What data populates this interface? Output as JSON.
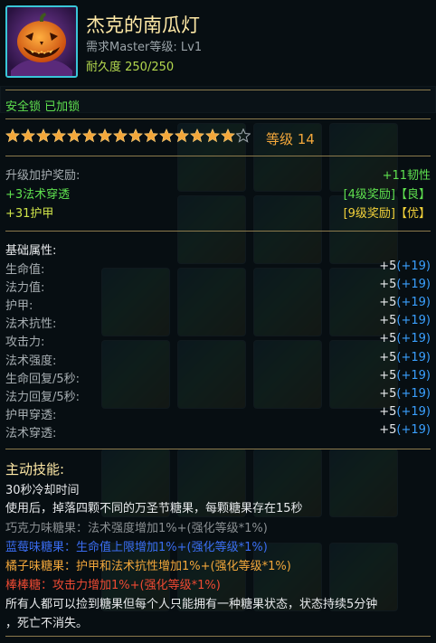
{
  "item": {
    "name": "杰克的南瓜灯",
    "requirement": "需求Master等级: Lv1",
    "durability": "耐久度 250/250",
    "lock_status": "安全锁 已加锁",
    "icon": "pumpkin-lantern-icon"
  },
  "enhance": {
    "stars_filled": 15,
    "stars_total": 16,
    "level_label": "等级 14"
  },
  "upgrade_bonus": {
    "label": "升级加护奖励:",
    "value": "+11韧性",
    "lines": [
      {
        "text": "+3法术穿透",
        "tag": "[4级奖励]",
        "quality": "【良】"
      },
      {
        "text": "+31护甲",
        "tag": "[9级奖励]",
        "quality": "【优】"
      }
    ]
  },
  "base_attrs": {
    "label": "基础属性:",
    "rows": [
      {
        "name": "生命值:",
        "base": "+5",
        "bonus": "(+19)"
      },
      {
        "name": "法力值:",
        "base": "+5",
        "bonus": "(+19)"
      },
      {
        "name": "护甲:",
        "base": "+5",
        "bonus": "(+19)"
      },
      {
        "name": "法术抗性:",
        "base": "+5",
        "bonus": "(+19)"
      },
      {
        "name": "攻击力:",
        "base": "+5",
        "bonus": "(+19)"
      },
      {
        "name": "法术强度:",
        "base": "+5",
        "bonus": "(+19)"
      },
      {
        "name": "生命回复/5秒:",
        "base": "+5",
        "bonus": "(+19)"
      },
      {
        "name": "法力回复/5秒:",
        "base": "+5",
        "bonus": "(+19)"
      },
      {
        "name": "护甲穿透:",
        "base": "+5",
        "bonus": "(+19)"
      },
      {
        "name": "法术穿透:",
        "base": "+5",
        "bonus": "(+19)"
      }
    ]
  },
  "skill": {
    "label": "主动技能:",
    "cooldown": "30秒冷却时间",
    "desc": "使用后，掉落四颗不同的万圣节糖果，每颗糖果存在15秒",
    "candies": [
      {
        "text": "巧克力味糖果：法术强度增加1%+(强化等级*1%)",
        "color": "#8a8f92"
      },
      {
        "text": "蓝莓味糖果：生命值上限增加1%+(强化等级*1%)",
        "color": "#3a6cf0"
      },
      {
        "text": "橘子味糖果：护甲和法术抗性增加1%+(强化等级*1%)",
        "color": "#f3a73b"
      },
      {
        "text": "棒棒糖：攻击力增加1%+(强化等级*1%)",
        "color": "#ee4a33"
      }
    ],
    "note_1": "所有人都可以捡到糖果但每个人只能拥有一种糖果状态，状态持续5分钟",
    "note_2": "，死亡不消失。"
  },
  "colors": {
    "title": "#ffe9a6",
    "green": "#5fe14f",
    "blue_bonus": "#3aa0ff",
    "star": "#f3a73b",
    "separator": "#8c7a4c"
  }
}
